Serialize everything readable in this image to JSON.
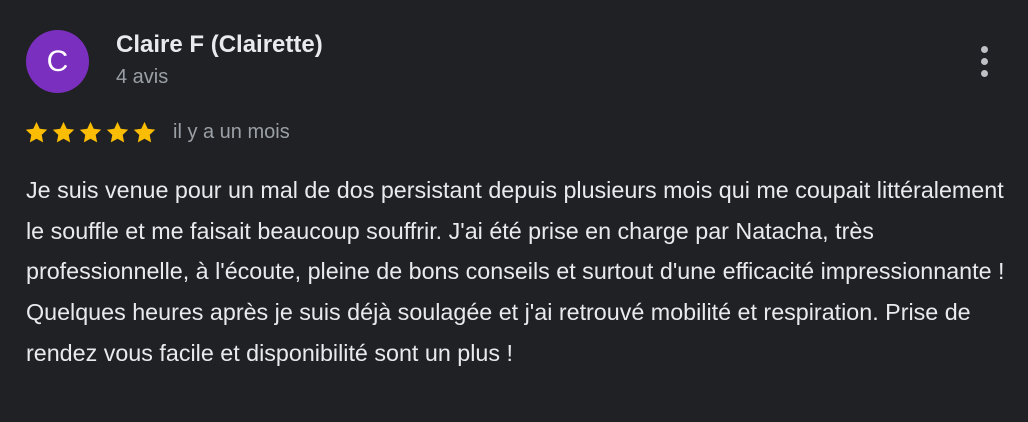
{
  "review": {
    "avatar_initial": "C",
    "avatar_color": "#7b2fbe",
    "author_name": "Claire F (Clairette)",
    "review_count": "4 avis",
    "rating": 5,
    "rating_max": 5,
    "star_color": "#fbbc04",
    "date": "il y a un mois",
    "more_icon": "more-vert-icon",
    "text_paragraph_1": "Je suis venue pour un mal de dos persistant depuis plusieurs mois qui me coupait littéralement le souffle et me faisait beaucoup souffrir. J'ai été prise en charge par Natacha, très professionnelle, à l'écoute, pleine de bons conseils et surtout d'une efficacité impressionnante !",
    "text_paragraph_2": "Quelques heures après je suis déjà soulagée et j'ai retrouvé mobilité et respiration. Prise de rendez vous facile et disponibilité sont un plus !"
  }
}
